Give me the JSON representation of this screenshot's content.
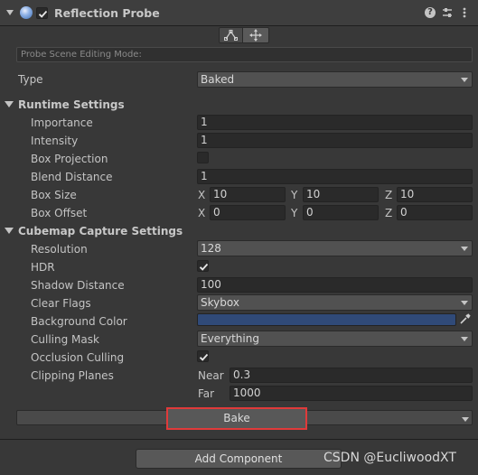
{
  "header": {
    "title": "Reflection Probe",
    "enabled": true
  },
  "scene_mode": {
    "label": "Probe Scene Editing Mode:"
  },
  "type": {
    "label": "Type",
    "value": "Baked"
  },
  "runtime": {
    "title": "Runtime Settings",
    "importance_label": "Importance",
    "importance": "1",
    "intensity_label": "Intensity",
    "intensity": "1",
    "box_projection_label": "Box Projection",
    "blend_distance_label": "Blend Distance",
    "blend_distance": "1",
    "box_size_label": "Box Size",
    "box_size": {
      "x": "10",
      "y": "10",
      "z": "10"
    },
    "box_offset_label": "Box Offset",
    "box_offset": {
      "x": "0",
      "y": "0",
      "z": "0"
    },
    "axis_x": "X",
    "axis_y": "Y",
    "axis_z": "Z"
  },
  "cubemap": {
    "title": "Cubemap Capture Settings",
    "resolution_label": "Resolution",
    "resolution": "128",
    "hdr_label": "HDR",
    "shadow_distance_label": "Shadow Distance",
    "shadow_distance": "100",
    "clear_flags_label": "Clear Flags",
    "clear_flags": "Skybox",
    "background_color_label": "Background Color",
    "background_color": "#304a78",
    "culling_mask_label": "Culling Mask",
    "culling_mask": "Everything",
    "occlusion_culling_label": "Occlusion Culling",
    "clipping_planes_label": "Clipping Planes",
    "near_label": "Near",
    "near": "0.3",
    "far_label": "Far",
    "far": "1000"
  },
  "bake": {
    "label": "Bake",
    "highlight_color": "#e03a3a"
  },
  "add_component": {
    "label": "Add Component"
  },
  "watermark": "CSDN @EucliwoodXT"
}
